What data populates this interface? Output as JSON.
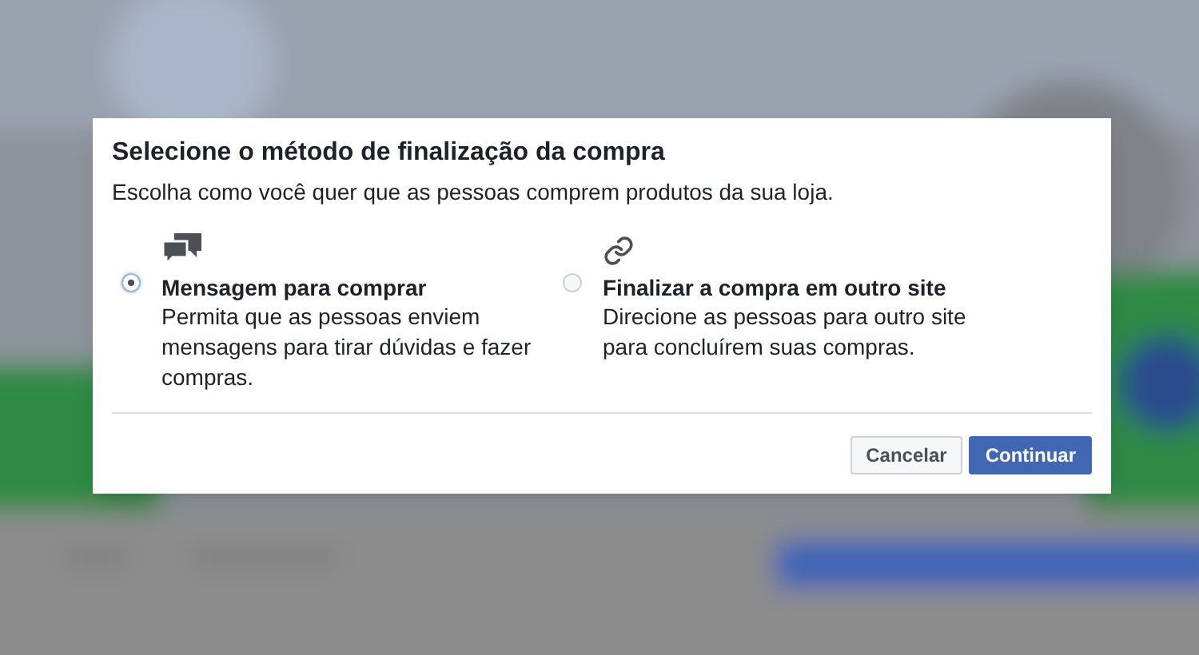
{
  "dialog": {
    "title": "Selecione o método de finalização da compra",
    "subtitle": "Escolha como você quer que as pessoas comprem produtos da sua loja.",
    "options": [
      {
        "kind": "chat",
        "label": "Mensagem para comprar",
        "description": "Permita que as pessoas enviem mensagens para tirar dúvidas e fazer compras.",
        "selected": true
      },
      {
        "kind": "link",
        "label": "Finalizar a compra em outro site",
        "description": "Direcione as pessoas para outro site para concluírem suas compras.",
        "selected": false
      }
    ],
    "buttons": [
      {
        "kind": "secondary",
        "label": "Cancelar"
      },
      {
        "kind": "primary",
        "label": "Continuar"
      }
    ]
  }
}
